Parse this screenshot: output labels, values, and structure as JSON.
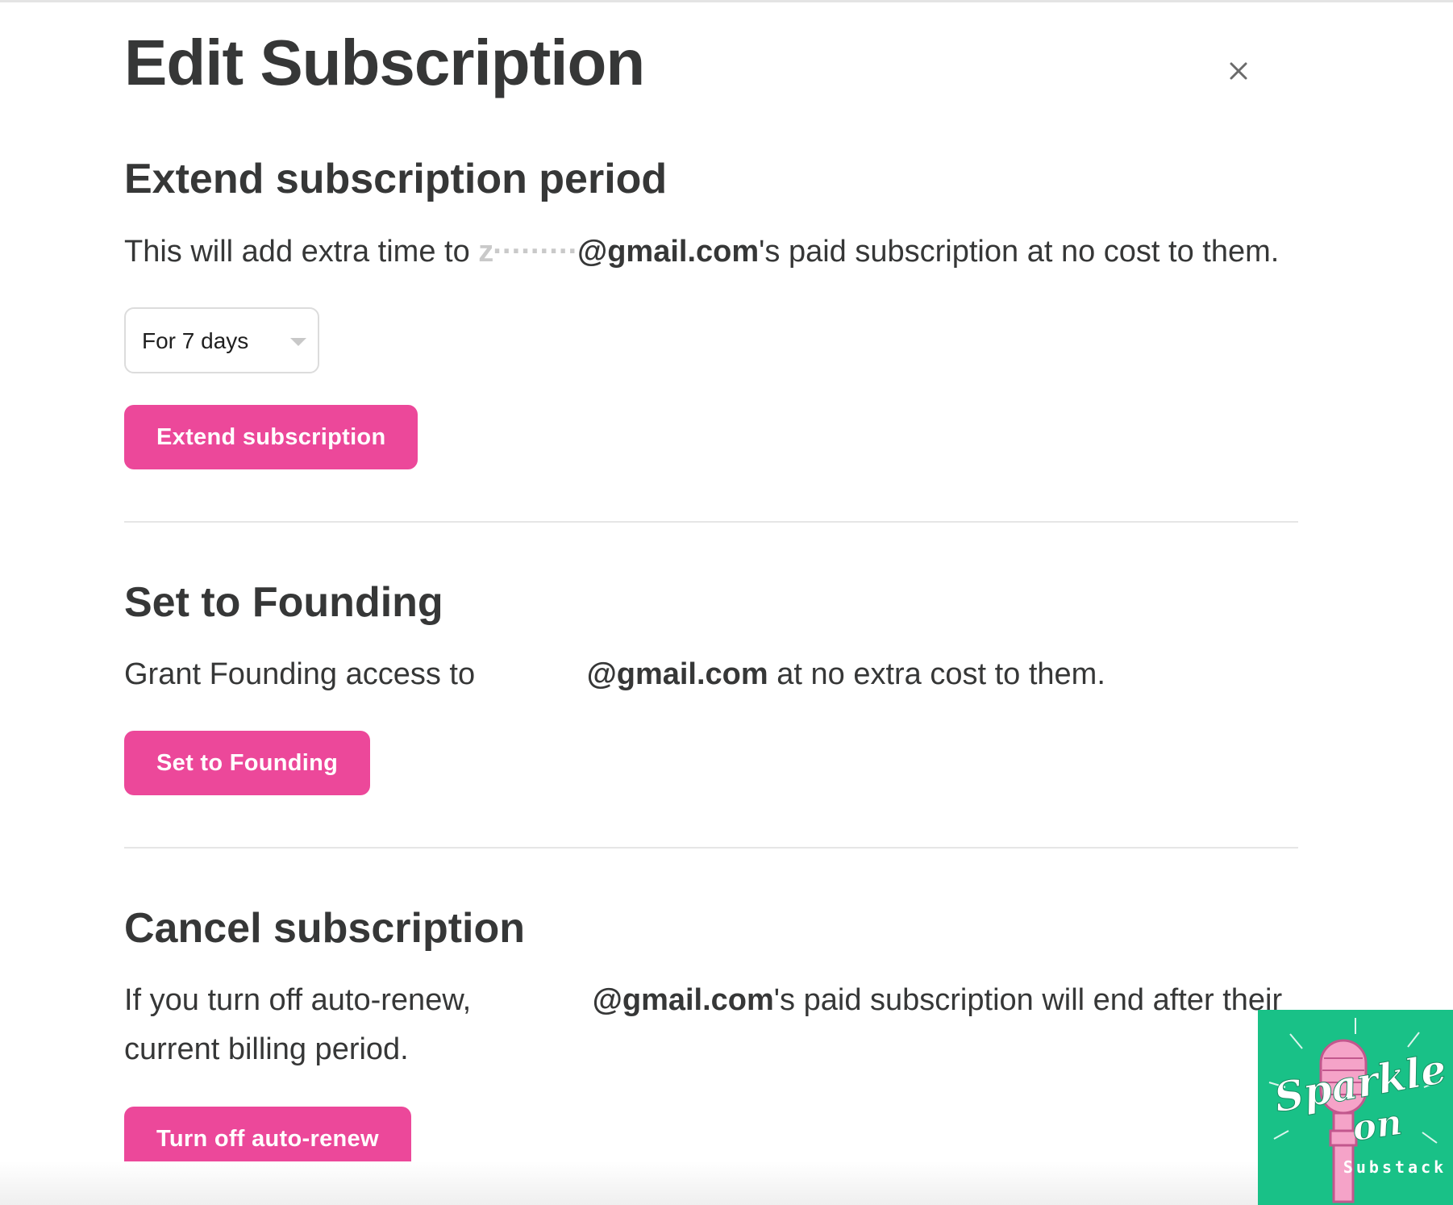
{
  "modal": {
    "title": "Edit Subscription",
    "close_icon": "close-icon"
  },
  "extend": {
    "heading": "Extend subscription period",
    "desc_prefix": "This will add extra time to ",
    "email_visible": "@gmail.com",
    "desc_suffix": "'s paid subscription at no cost to them.",
    "duration_selected": "For 7 days",
    "button_label": "Extend subscription"
  },
  "founding": {
    "heading": "Set to Founding",
    "desc_prefix": "Grant Founding access to ",
    "email_visible": "@gmail.com",
    "desc_suffix": " at no extra cost to them.",
    "button_label": "Set to Founding"
  },
  "cancel": {
    "heading": "Cancel subscription",
    "desc_prefix": "If you turn off auto-renew, ",
    "email_visible": "@gmail.com",
    "desc_suffix": "'s paid subscription will end after their current billing period.",
    "button_label": "Turn off auto-renew"
  },
  "watermark": {
    "line1": "Sparkle",
    "line2": "on",
    "line3": "Substack",
    "bg_color": "#19c187",
    "accent_color": "#f5a3c8"
  },
  "colors": {
    "primary_button": "#ec489a",
    "text": "#363737",
    "divider": "#e6e6e6"
  }
}
